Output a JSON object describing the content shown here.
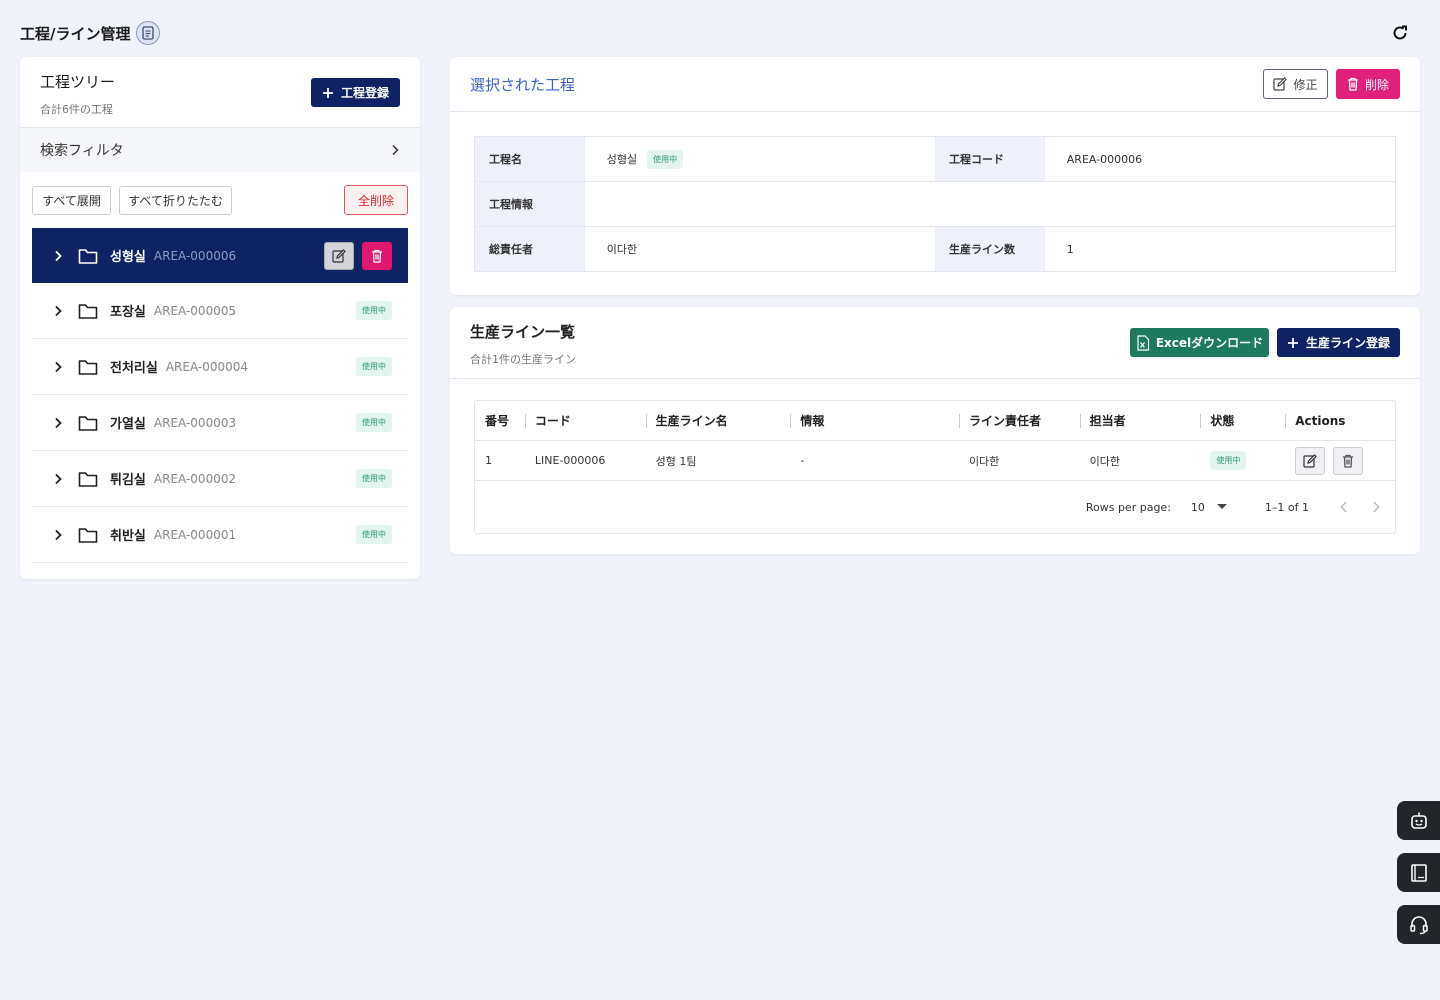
{
  "page": {
    "title": "工程/ライン管理"
  },
  "tree": {
    "title": "工程ツリー",
    "subtitle": "合計6件の工程",
    "register_label": "工程登録",
    "filter_label": "検索フィルタ",
    "expand_all": "すべて展開",
    "collapse_all": "すべて折りたたむ",
    "delete_all": "全削除",
    "items": [
      {
        "name": "성형실",
        "code": "AREA-000006",
        "status": "使用中"
      },
      {
        "name": "포장실",
        "code": "AREA-000005",
        "status": "使用中"
      },
      {
        "name": "전처리실",
        "code": "AREA-000004",
        "status": "使用中"
      },
      {
        "name": "가열실",
        "code": "AREA-000003",
        "status": "使用中"
      },
      {
        "name": "튀김실",
        "code": "AREA-000002",
        "status": "使用中"
      },
      {
        "name": "취반실",
        "code": "AREA-000001",
        "status": "使用中"
      }
    ]
  },
  "detail": {
    "title": "選択された工程",
    "edit_label": "修正",
    "delete_label": "削除",
    "labels": {
      "name": "工程名",
      "code": "工程コード",
      "info": "工程情報",
      "manager": "総責任者",
      "line_count": "生産ライン数"
    },
    "values": {
      "name": "성형실",
      "status": "使用中",
      "code": "AREA-000006",
      "info": "",
      "manager": "이다한",
      "line_count": "1"
    }
  },
  "lines": {
    "title": "生産ライン一覧",
    "subtitle": "合計1件の生産ライン",
    "excel_label": "Excelダウンロード",
    "register_label": "生産ライン登録",
    "columns": [
      "番号",
      "コード",
      "生産ライン名",
      "情報",
      "ライン責任者",
      "担当者",
      "状態",
      "Actions"
    ],
    "rows": [
      {
        "no": "1",
        "code": "LINE-000006",
        "name": "성형 1팀",
        "info": "-",
        "line_manager": "이다한",
        "assignee": "이다한",
        "status": "使用中"
      }
    ],
    "footer": {
      "rows_per_page_label": "Rows per page:",
      "rows_per_page": "10",
      "range": "1–1 of 1"
    }
  },
  "colors": {
    "primary": "#0f2263",
    "accent_blue": "#3b62c4",
    "danger": "#e0207a",
    "excel": "#1e7a5f",
    "status_bg": "#e4f4ee",
    "status_fg": "#2b9a72"
  }
}
